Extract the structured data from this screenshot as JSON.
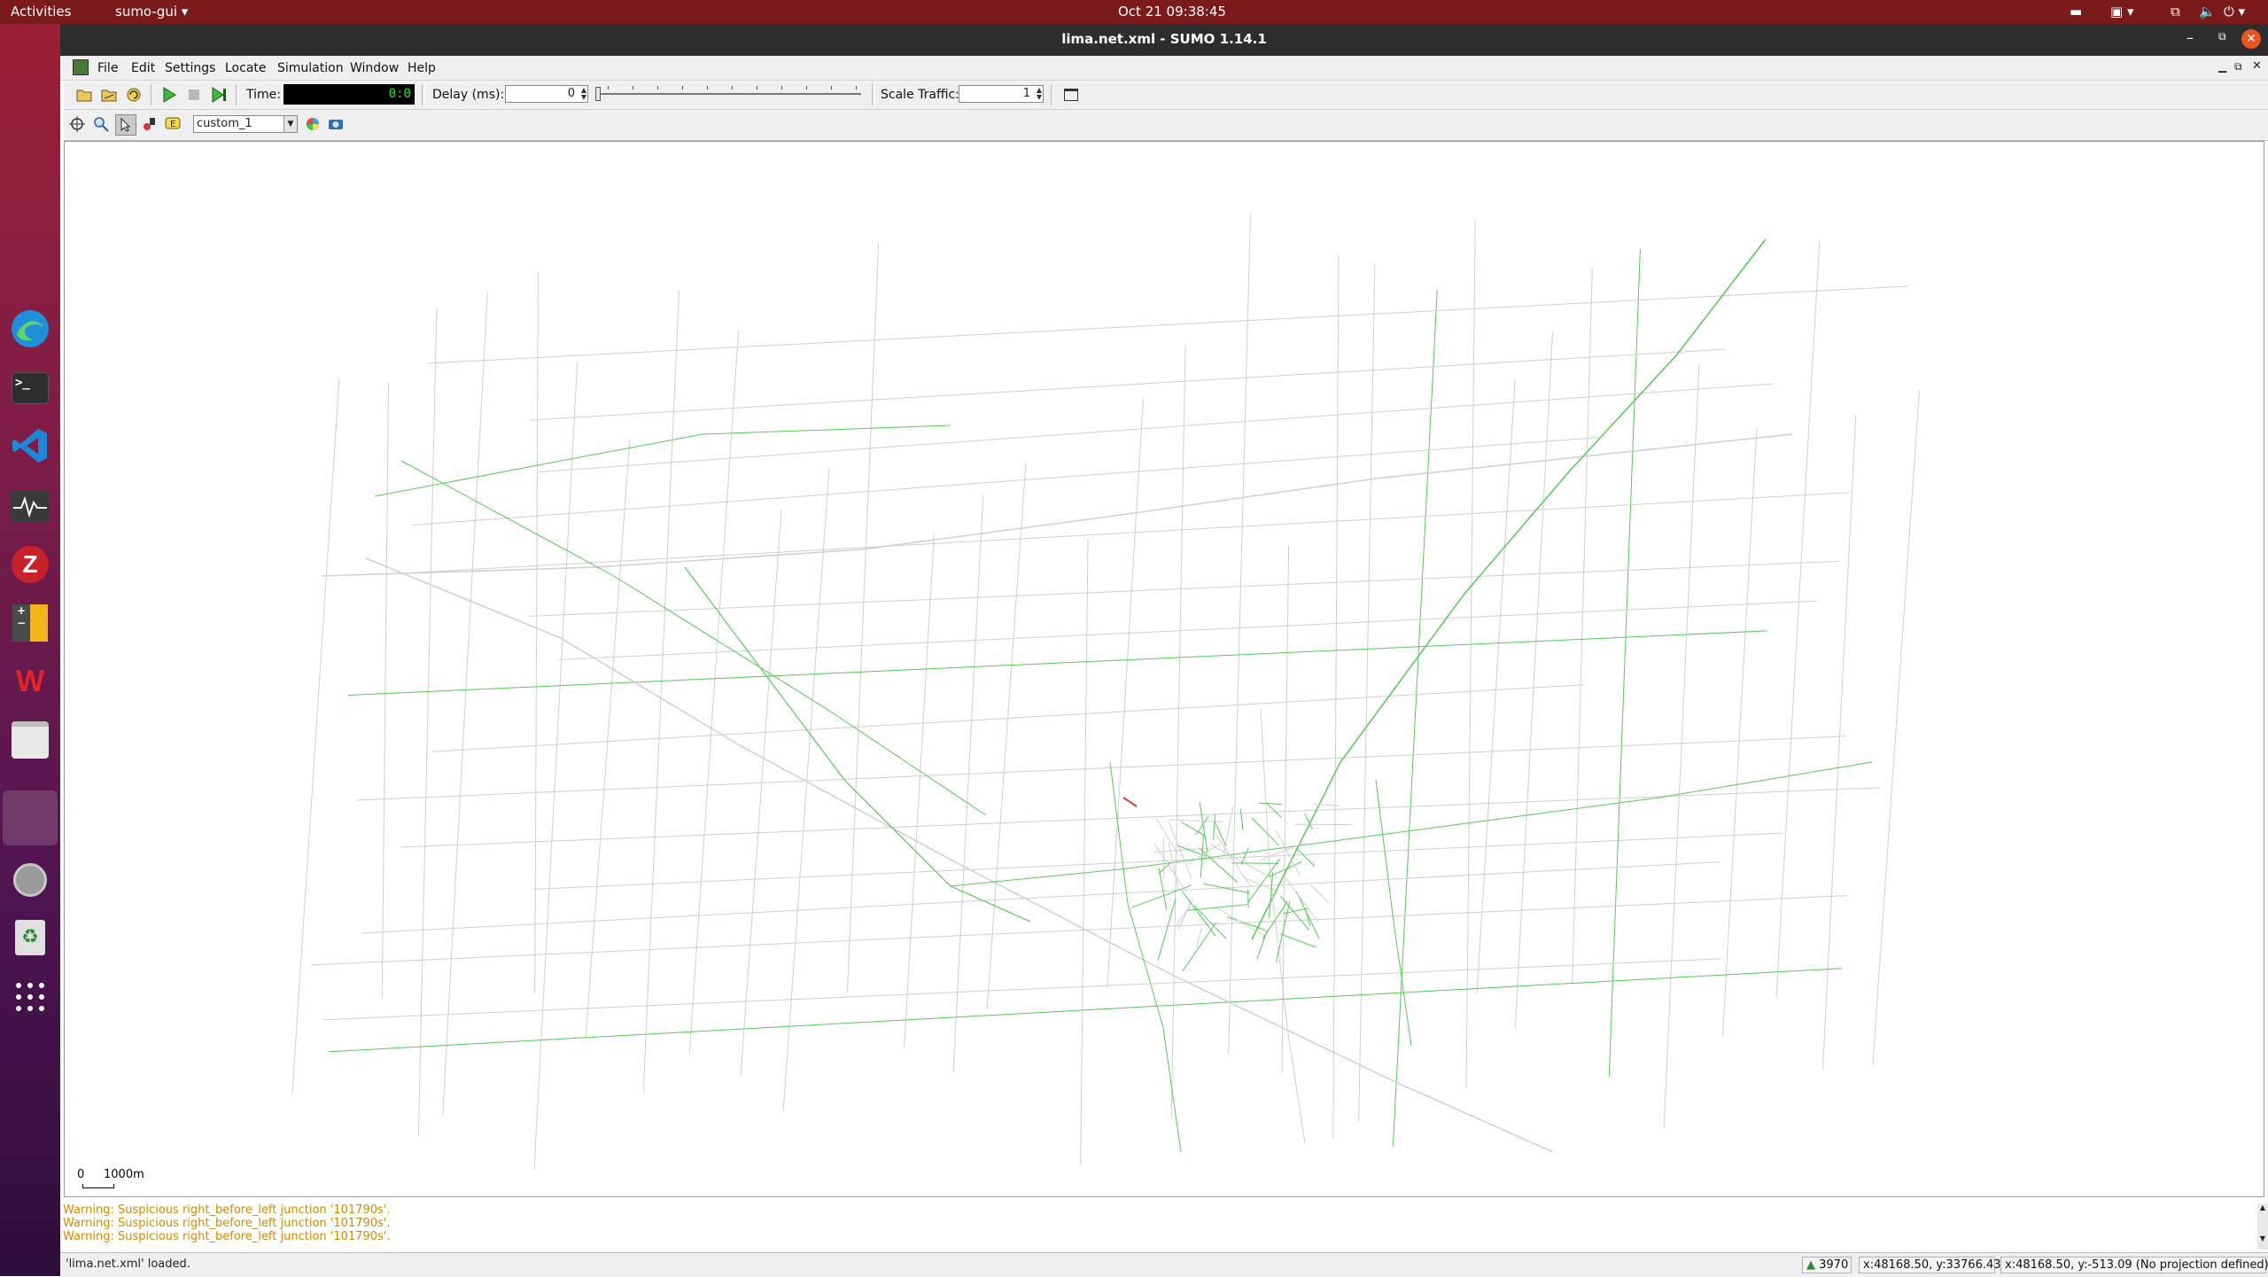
{
  "topbar": {
    "activities": "Activities",
    "app_menu": "sumo-gui ▾",
    "clock": "Oct 21  09:38:45"
  },
  "dock": {
    "items": [
      "edge-browser",
      "terminal",
      "vscode",
      "system-monitor",
      "zotero",
      "calculator",
      "wps-office",
      "files",
      "active-window",
      "disk",
      "trash",
      "app-grid"
    ]
  },
  "window": {
    "title": "lima.net.xml - SUMO 1.14.1"
  },
  "menu": {
    "items": [
      "File",
      "Edit",
      "Settings",
      "Locate",
      "Simulation",
      "Window",
      "Help"
    ]
  },
  "toolbar": {
    "time_label": "Time:",
    "time_value": "0:0",
    "delay_label": "Delay (ms):",
    "delay_value": "0",
    "scale_label": "Scale Traffic:",
    "scale_value": "1"
  },
  "viewbar": {
    "scheme": "custom_1"
  },
  "map": {
    "scale_start": "0",
    "scale_end": "1000m",
    "road_color": "#cfcfcf",
    "active_road_color": "#58c858",
    "jam_color": "#d04040"
  },
  "log": {
    "lines": [
      "Warning: Suspicious right_before_left junction '101790s'.",
      "Warning: Suspicious right_before_left junction '101790s'.",
      "Warning: Suspicious right_before_left junction '101790s'."
    ]
  },
  "status": {
    "message": "'lima.net.xml' loaded.",
    "vehicle_count": "3970",
    "coords_net": "x:48168.50, y:33766.43",
    "coords_geo": "x:48168.50, y:-513.09 (No projection defined)"
  }
}
